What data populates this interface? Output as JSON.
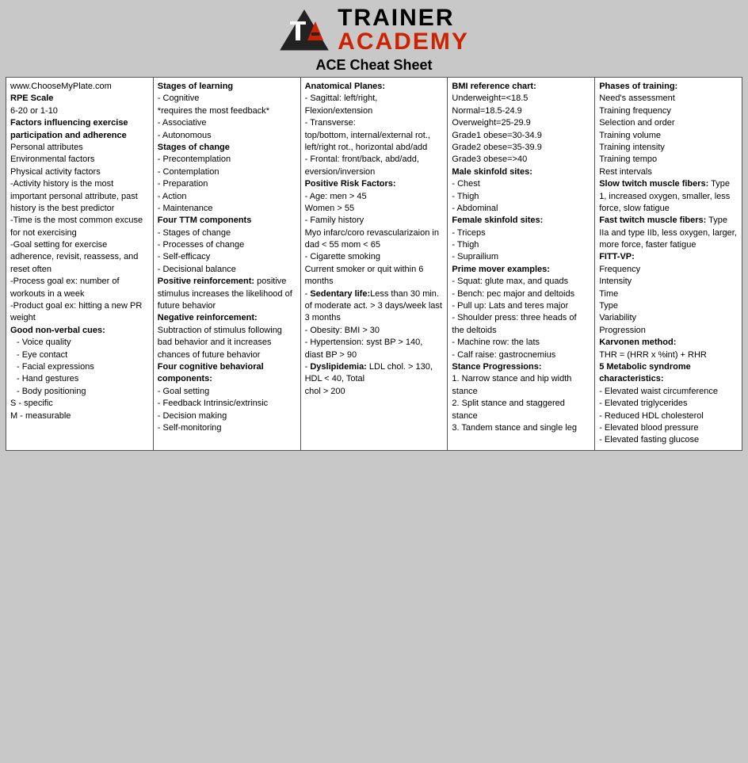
{
  "header": {
    "logo_trainer": "TRAINER",
    "logo_academy": "ACADEMY",
    "page_title": "ACE Cheat Sheet"
  },
  "columns": [
    {
      "id": "col1",
      "content": [
        "www.ChooseMyPlate.com",
        "RPE Scale",
        "6-20 or 1-10",
        "Factors influencing exercise participation and adherence",
        "Personal attributes",
        "Environmental factors",
        "Physical activity factors",
        "-Activity history is the most important personal attribute, past history is the best predictor",
        "-Time is the most common excuse for not exercising",
        "-Goal setting for exercise adherence, revisit, reassess, and reset often",
        "-Process goal ex: number of workouts in a week",
        "-Product goal ex: hitting a new PR weight",
        "Good non-verbal cues:",
        "- Voice quality",
        "- Eye contact",
        "- Facial expressions",
        "- Hand gestures",
        "- Body positioning",
        "S - specific",
        "M - measurable"
      ]
    },
    {
      "id": "col2",
      "content": [
        "Stages of learning",
        "- Cognitive",
        "*requires the most feedback*",
        "- Associative",
        "- Autonomous",
        "Stages of change",
        "- Precontemplation",
        "- Contemplation",
        "- Preparation",
        "- Action",
        "- Maintenance",
        "Four TTM components",
        "- Stages of change",
        "- Processes of change",
        "- Self-efficacy",
        "- Decisional balance",
        "Positive reinforcement: positive stimulus increases the likelihood of future behavior",
        "Negative reinforcement: Subtraction of stimulus following bad behavior and it increases chances of future behavior",
        "Four cognitive behavioral components:",
        "- Goal setting",
        "- Feedback Intrinsic/extrinsic",
        "- Decision making",
        "- Self-monitoring"
      ]
    },
    {
      "id": "col3",
      "content": [
        "Anatomical Planes:",
        "- Sagittal: left/right, Flexion/extension",
        "- Transverse:",
        "top/bottom, internal/external rot., left/right rot., horizontal abd/add",
        "- Frontal: front/back, abd/add, eversion/inversion",
        "Positive Risk Factors:",
        "- Age: men > 45",
        "Women > 55",
        "- Family history",
        "Myo infarc/coro revascularizaion in dad < 55 mom < 65",
        "- Cigarette smoking",
        "Current smoker or quit within 6 months",
        "- Sedentary life: Less than 30 min. of moderate act. > 3 days/week last 3 months",
        "- Obesity: BMI > 30",
        "- Hypertension: syst BP > 140, diast BP > 90",
        "- Dyslipidemia: LDL chol. > 130, HDL < 40, Total",
        "chol > 200"
      ]
    },
    {
      "id": "col4",
      "content": [
        "BMI reference chart:",
        "Underweight=<18.5",
        "Normal=18.5-24.9",
        "Overweight=25-29.9",
        "Grade1 obese=30-34.9",
        "Grade2 obese=35-39.9",
        "Grade3 obese=>40",
        "Male skinfold sites:",
        "- Chest",
        "- Thigh",
        "- Abdominal",
        "Female skinfold sites:",
        "- Triceps",
        "- Thigh",
        "- Suprailium",
        "Prime mover examples:",
        "- Squat: glute max, and quads",
        "- Bench: pec major and deltoids",
        "- Pull up: Lats and teres major",
        "- Shoulder press: three heads of the deltoids",
        "- Machine row: the lats",
        "- Calf raise: gastrocnemius",
        "Stance Progressions:",
        "1. Narrow stance and hip width stance",
        "2. Split stance and staggered stance",
        "3. Tandem stance and single leg"
      ]
    },
    {
      "id": "col5",
      "content": [
        "Phases of training:",
        "Need's assessment",
        "Training frequency",
        "Selection and order",
        "Training volume",
        "Training intensity",
        "Training tempo",
        "Rest intervals",
        "Slow twitch muscle fibers: Type 1, increased oxygen, smaller, less force, slow fatigue",
        "Fast twitch muscle fibers: Type IIa and type IIb, less oxygen, larger, more force, faster fatigue",
        "FITT-VP:",
        "Frequency",
        "Intensity",
        "Time",
        "Type",
        "Variability",
        "Progression",
        "Karvonen method:",
        "THR = (HRR x %int) + RHR",
        "5 Metabolic syndrome characteristics:",
        "- Elevated waist circumference",
        "- Elevated triglycerides",
        "- Reduced HDL cholesterol",
        "- Elevated blood pressure",
        "- Elevated fasting glucose"
      ]
    }
  ]
}
